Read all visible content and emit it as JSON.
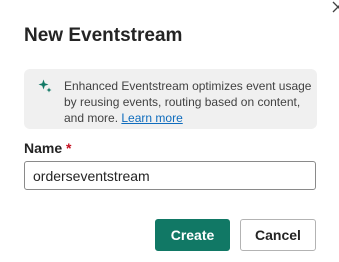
{
  "dialog": {
    "title": "New Eventstream",
    "info": {
      "icon": "sparkle-icon",
      "text": "Enhanced Eventstream optimizes event usage by reusing events, routing based on content, and more.",
      "link_label": "Learn more"
    },
    "name_field": {
      "label": "Name",
      "required_marker": "*",
      "value": "orderseventstream"
    },
    "buttons": {
      "create_label": "Create",
      "cancel_label": "Cancel"
    }
  },
  "colors": {
    "primary": "#117865",
    "link": "#0f6cbd",
    "required": "#c50f1f",
    "info_background": "#f0f0f0"
  }
}
